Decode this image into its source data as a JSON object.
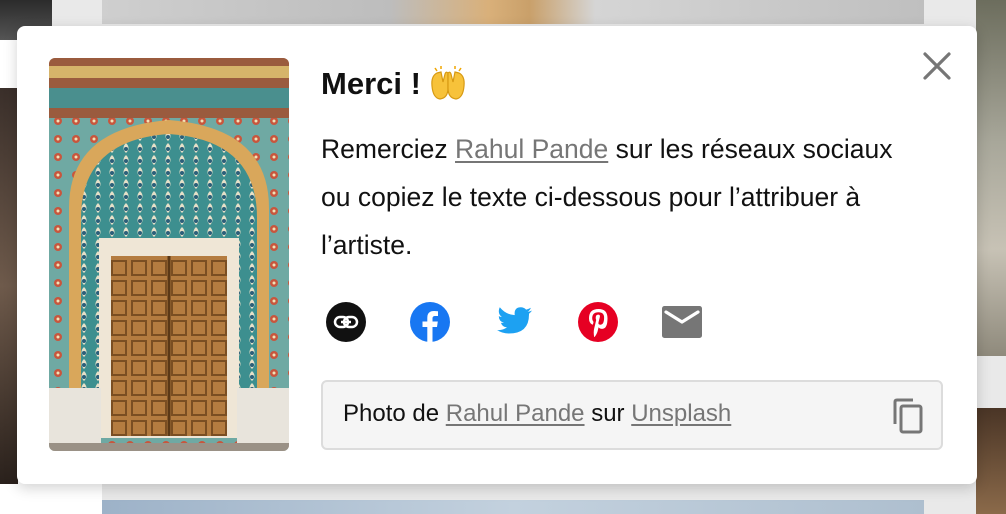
{
  "modal": {
    "title": "Merci !",
    "title_emoji": "raising-hands",
    "description_before": "Remerciez ",
    "author_name": "Rahul Pande",
    "description_after": " sur les réseaux sociaux ou copiez le texte ci-dessous pour l’attribuer à l’artiste.",
    "photo_icon": "jaipur-doorway-photo"
  },
  "share": [
    {
      "name": "link",
      "icon": "link-icon",
      "color": "#111111"
    },
    {
      "name": "facebook",
      "icon": "facebook-icon",
      "color": "#1877f2"
    },
    {
      "name": "twitter",
      "icon": "twitter-icon",
      "color": "#1da1f2"
    },
    {
      "name": "pinterest",
      "icon": "pinterest-icon",
      "color": "#e60023"
    },
    {
      "name": "email",
      "icon": "email-icon",
      "color": "#767676"
    }
  ],
  "credit": {
    "prefix": "Photo de ",
    "author": "Rahul Pande",
    "middle": " sur ",
    "site": "Unsplash"
  }
}
